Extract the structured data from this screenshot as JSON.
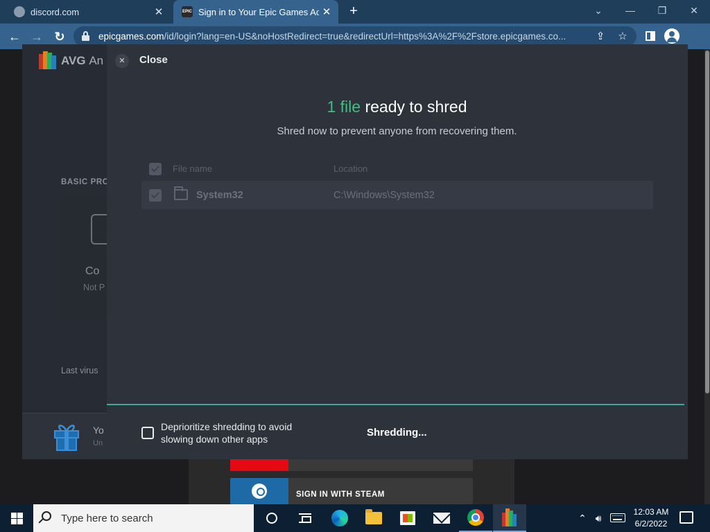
{
  "browser": {
    "tabs": [
      {
        "title": "discord.com",
        "favicon": "globe-icon",
        "active": false
      },
      {
        "title": "Sign in to Your Epic Games Acco",
        "favicon_text": "EPIC",
        "active": true
      }
    ],
    "url_host": "epicgames.com",
    "url_path": "/id/login?lang=en-US&noHostRedirect=true&redirectUrl=https%3A%2F%2Fstore.epicgames.co...",
    "icons": {
      "back": "←",
      "forward": "→",
      "reload": "↻",
      "share": "⇪",
      "star": "☆",
      "new_tab": "+",
      "tab_close": "✕",
      "minimize": "—",
      "restore": "❐",
      "close": "✕",
      "tab_list": "⌄"
    }
  },
  "avg": {
    "brand": "AVG",
    "brand_suffix": "An",
    "basic_protection": "BASIC PRO",
    "card_title": "Co",
    "card_sub": "Not P",
    "last_virus": "Last virus",
    "bottom_title": "Yo",
    "bottom_sub": "Un"
  },
  "dialog": {
    "close_label": "Close",
    "close_glyph": "✕",
    "title_accent": "1 file",
    "title_rest": " ready to shred",
    "subtitle": "Shred now to prevent anyone from recovering them.",
    "columns": {
      "file_name": "File name",
      "location": "Location"
    },
    "files": [
      {
        "name": "System32",
        "location": "C:\\Windows\\System32"
      }
    ],
    "deprioritize_label": "Deprioritize shredding to avoid slowing down other apps",
    "status": "Shredding...",
    "progress": 0.995
  },
  "epic": {
    "steam_label": "SIGN IN WITH STEAM"
  },
  "taskbar": {
    "search_placeholder": "Type here to search",
    "time": "12:03 AM",
    "date": "6/2/2022",
    "tray_icons": [
      "chevron-up-icon",
      "speaker-icon",
      "keyboard-icon"
    ]
  },
  "colors": {
    "accent_green": "#3fbf7f",
    "progress": "#3fa89a",
    "dialog_bg": "#2d323b",
    "tab_active": "#35638d"
  }
}
